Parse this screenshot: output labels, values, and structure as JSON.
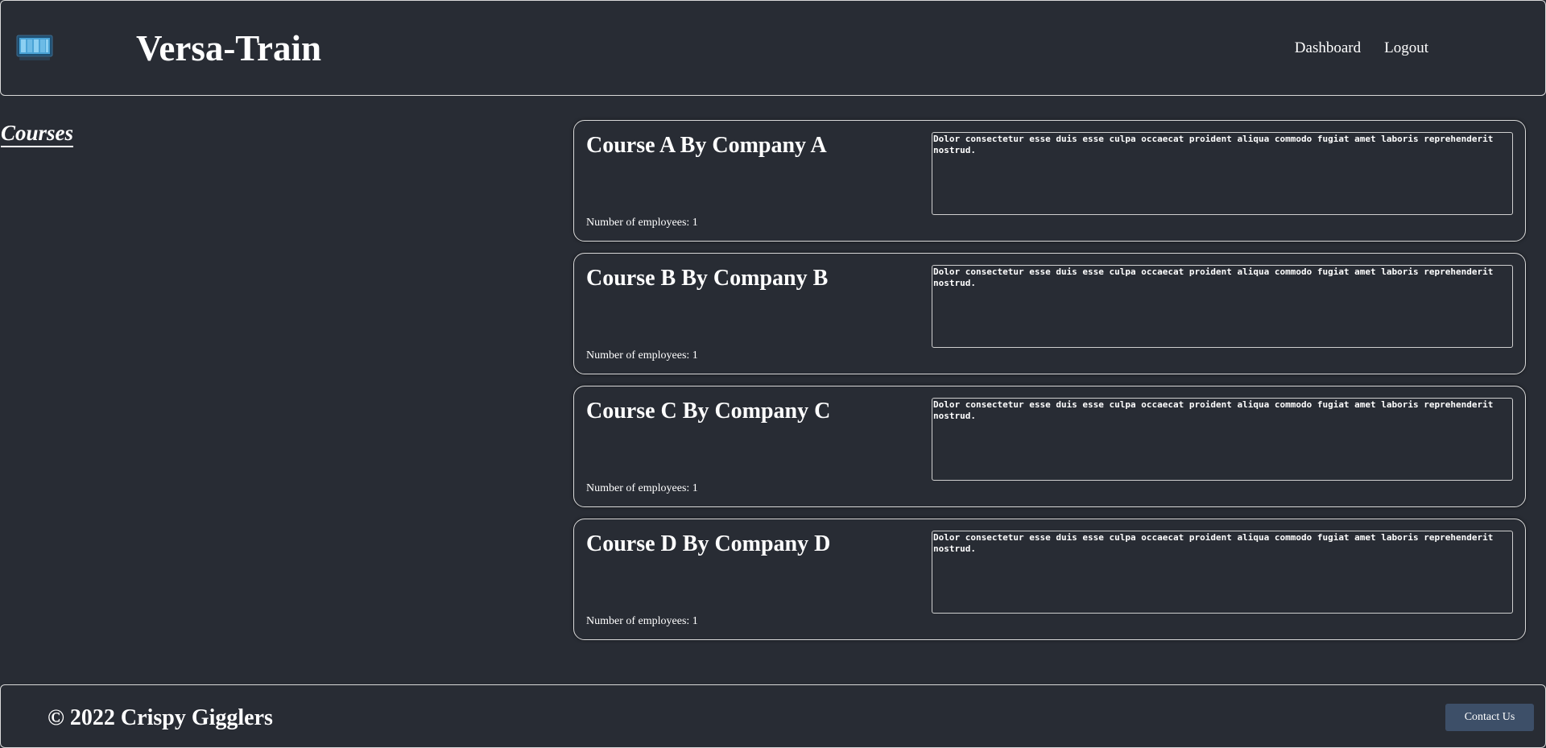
{
  "header": {
    "brand": "Versa-Train",
    "logo_icon": "monitor-logo-icon",
    "nav": {
      "dashboard_label": "Dashboard",
      "logout_label": "Logout"
    }
  },
  "main": {
    "section_title": "Courses",
    "courses": [
      {
        "title": "Course A By Company A",
        "employees": "Number of employees: 1",
        "description": "Dolor consectetur esse duis esse culpa occaecat proident aliqua commodo fugiat amet laboris reprehenderit nostrud."
      },
      {
        "title": "Course B By Company B",
        "employees": "Number of employees: 1",
        "description": "Dolor consectetur esse duis esse culpa occaecat proident aliqua commodo fugiat amet laboris reprehenderit nostrud."
      },
      {
        "title": "Course C By Company C",
        "employees": "Number of employees: 1",
        "description": "Dolor consectetur esse duis esse culpa occaecat proident aliqua commodo fugiat amet laboris reprehenderit nostrud."
      },
      {
        "title": "Course D By Company D",
        "employees": "Number of employees: 1",
        "description": "Dolor consectetur esse duis esse culpa occaecat proident aliqua commodo fugiat amet laboris reprehenderit nostrud."
      }
    ]
  },
  "footer": {
    "copyright": "© 2022 Crispy Gigglers",
    "contact_label": "Contact Us"
  },
  "colors": {
    "background": "#282c34",
    "border": "#d9d9d9",
    "contact_button": "#3d4f68"
  }
}
